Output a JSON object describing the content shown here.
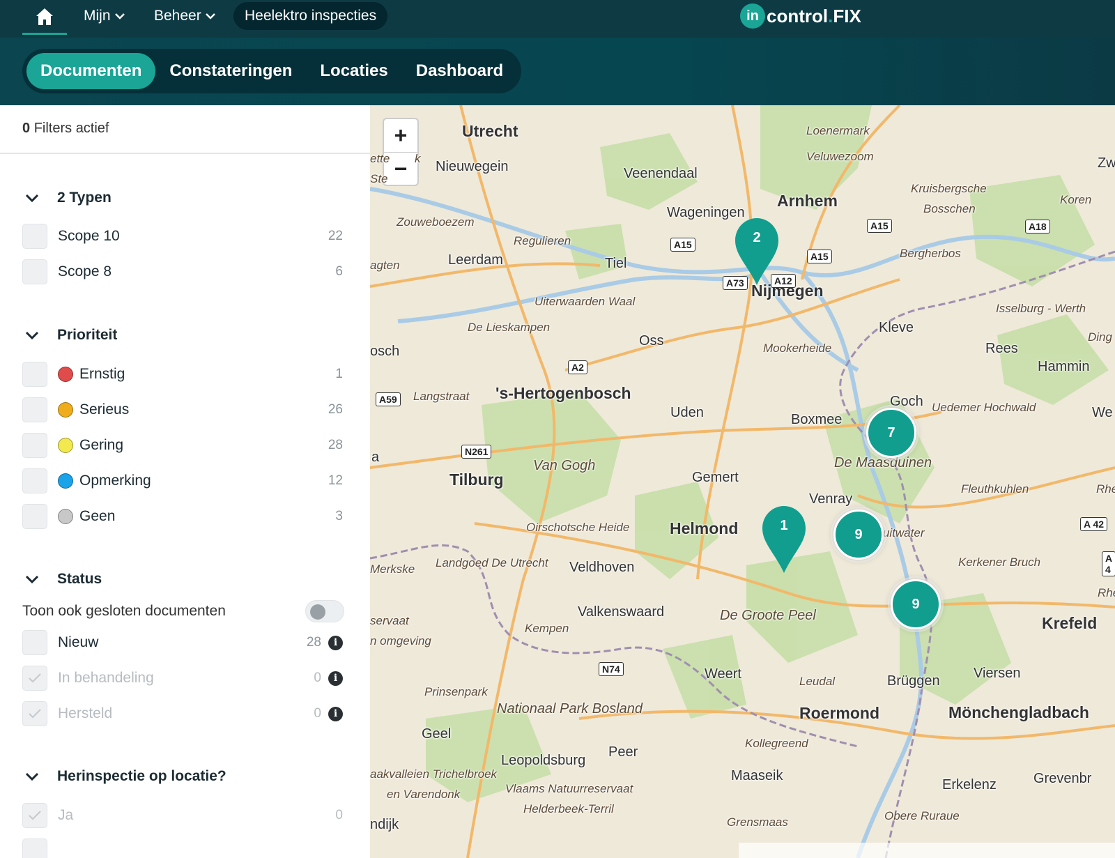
{
  "topnav": {
    "menu_mine": "Mijn",
    "menu_manage": "Beheer",
    "client": "Heelektro inspecties",
    "logo_badge": "in",
    "logo_text": "control",
    "logo_dot": ".",
    "logo_fix": "FIX"
  },
  "tabs": [
    "Documenten",
    "Constateringen",
    "Locaties",
    "Dashboard"
  ],
  "sidebar": {
    "filters_count": "0",
    "filters_label": "Filters actief",
    "types": {
      "heading": "2 Typen",
      "items": [
        {
          "label": "Scope 10",
          "count": "22"
        },
        {
          "label": "Scope 8",
          "count": "6"
        }
      ]
    },
    "priority": {
      "heading": "Prioriteit",
      "items": [
        {
          "label": "Ernstig",
          "count": "1",
          "color": "#e04b4b"
        },
        {
          "label": "Serieus",
          "count": "26",
          "color": "#f0ad1b"
        },
        {
          "label": "Gering",
          "count": "28",
          "color": "#f2e94e"
        },
        {
          "label": "Opmerking",
          "count": "12",
          "color": "#1aa3e8"
        },
        {
          "label": "Geen",
          "count": "3",
          "color": "#c8c8c8"
        }
      ]
    },
    "status": {
      "heading": "Status",
      "toggle_label": "Toon ook gesloten documenten",
      "items": [
        {
          "label": "Nieuw",
          "count": "28"
        },
        {
          "label": "In behandeling",
          "count": "0"
        },
        {
          "label": "Hersteld",
          "count": "0"
        }
      ]
    },
    "reinspection": {
      "heading": "Herinspectie op locatie?",
      "items": [
        {
          "label": "Ja",
          "count": "0"
        }
      ]
    }
  },
  "map": {
    "zoom_in": "+",
    "zoom_out": "−",
    "places": {
      "utrecht": "Utrecht",
      "nieuwegein": "Nieuwegein",
      "veenendaal": "Veenendaal",
      "arnhem": "Arnhem",
      "wageningen": "Wageningen",
      "nijmegen": "Nijmegen",
      "leerdam": "Leerdam",
      "tiel": "Tiel",
      "oss": "Oss",
      "kleve": "Kleve",
      "rees": "Rees",
      "hertogenbosch": "'s-Hertogenbosch",
      "uden": "Uden",
      "boxmeer": "Boxmee",
      "goch": "Goch",
      "tilburg": "Tilburg",
      "gemert": "Gemert",
      "helmond": "Helmond",
      "venray": "Venray",
      "veldhoven": "Veldhoven",
      "valkenswaard": "Valkenswaard",
      "krefeld": "Krefeld",
      "weert": "Weert",
      "bruggen": "Brüggen",
      "viersen": "Viersen",
      "roermond": "Roermond",
      "monchengladbach": "Mönchengladbach",
      "geel": "Geel",
      "leopoldsburg": "Leopoldsburg",
      "peer": "Peer",
      "maaseik": "Maaseik",
      "erkelenz": "Erkelenz",
      "grevenbroich": "Grevenbr",
      "hamminkeln": "Hammin",
      "we": "We",
      "zw": "Zw",
      "oosch": "osch",
      "a": "a"
    },
    "areas": {
      "loenermark": "Loenermark",
      "veluwezoom": "Veluwezoom",
      "kruisbergsche": "Kruisbergsche",
      "bosschen": "Bosschen",
      "koren": "Koren",
      "zouweboezem": "Zouweboezem",
      "regulieren": "Regulieren",
      "bergherbos": "Bergherbos",
      "uiterwaarden": "Uiterwaarden Waal",
      "lieskampen": "De Lieskampen",
      "mookerheide": "Mookerheide",
      "isselburg": "Isselburg - Werth",
      "ding": "Ding",
      "langstraat": "Langstraat",
      "uedemer": "Uedemer Hochwald",
      "maasduinen": "De Maasduinen",
      "vangogh": "Van Gogh",
      "fleuthkuhlen": "Fleuthkuhlen",
      "rhe": "Rhe",
      "oirschotsche": "Oirschotsche Heide",
      "schuitwater": "chuitwater",
      "merkske": "Merkske",
      "landgoed": "Landgoed De Utrecht",
      "kerkener": "Kerkener Bruch",
      "rhein": "Rhein",
      "servaat": "servaat",
      "omgeving": "n omgeving",
      "kempen": "Kempen",
      "grootepeel": "De Groote Peel",
      "leudal": "Leudal",
      "prinsenpark": "Prinsenpark",
      "bosland": "Nationaal Park Bosland",
      "kollegreend": "Kollegreend",
      "trichelbroek": "aakvalleien Trichelbroek",
      "varendonk": "en Varendonk",
      "vlaams": "Vlaams Natuurreservaat",
      "helderbeek": "Helderbeek-Terril",
      "grensmaas": "Grensmaas",
      "obere": "Obere Ruraue",
      "agten": "agten",
      "ndijk": "ndijk",
      "ette": "ette",
      "k": "k",
      "ste": "Ste"
    },
    "roads": {
      "a12": "A12",
      "a15a": "A15",
      "a15b": "A15",
      "a15c": "A15",
      "a18": "A18",
      "a73": "A73",
      "a2": "A2",
      "a59": "A59",
      "n261": "N261",
      "a42": "A 42",
      "a4x": "A 4",
      "n74": "N74"
    },
    "markers": {
      "pin_nijmegen": "2",
      "cluster_boxmeer": "7",
      "pin_helmond": "1",
      "cluster_venray": "9",
      "cluster_venlo": "9"
    }
  },
  "colors": {
    "brand": "#1aa596",
    "header": "#0e3a44",
    "marker": "#119e8f"
  }
}
